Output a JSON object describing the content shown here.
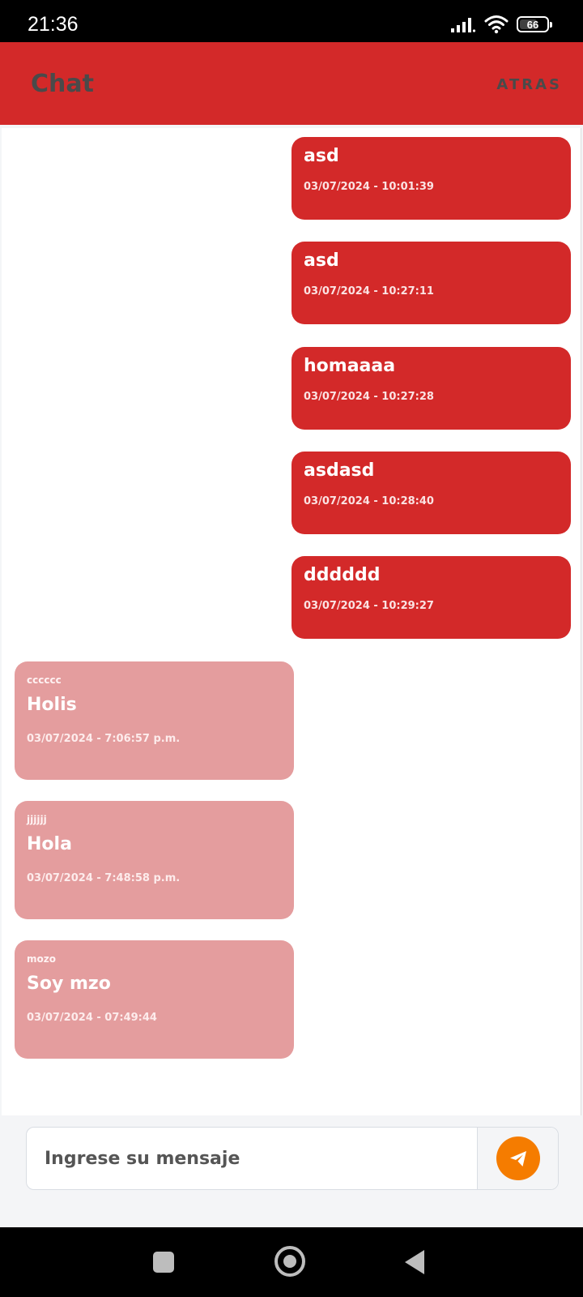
{
  "status_bar": {
    "time": "21:36",
    "battery": "66",
    "battery_percent": 66,
    "icons": [
      "signal-icon",
      "wifi-icon",
      "battery-icon"
    ]
  },
  "app_bar": {
    "title": "Chat",
    "back_label": "ATRAS"
  },
  "messages": {
    "sent": [
      {
        "text": "asd",
        "time": "03/07/2024 - 10:01:39"
      },
      {
        "text": "asd",
        "time": "03/07/2024 - 10:27:11"
      },
      {
        "text": "homaaaa",
        "time": "03/07/2024 - 10:27:28"
      },
      {
        "text": "asdasd",
        "time": "03/07/2024 - 10:28:40"
      },
      {
        "text": "dddddd",
        "time": "03/07/2024 - 10:29:27"
      }
    ],
    "received": [
      {
        "sender": "cccccc",
        "text": "Holis",
        "time": "03/07/2024 - 7:06:57 p.m."
      },
      {
        "sender": "jjjjjj",
        "text": "Hola",
        "time": "03/07/2024 - 7:48:58 p.m."
      },
      {
        "sender": "mozo",
        "text": "Soy mzo",
        "time": "03/07/2024 - 07:49:44"
      }
    ]
  },
  "composer": {
    "placeholder": "Ingrese su mensaje",
    "value": "",
    "send_icon": "send-icon"
  },
  "colors": {
    "primary": "#d32929",
    "received_bubble": "#e49d9e",
    "send_button": "#f57c00",
    "title_text": "#4a4a4a"
  },
  "nav_bar": {
    "icons": [
      "recent-apps-icon",
      "home-icon",
      "back-icon"
    ]
  }
}
